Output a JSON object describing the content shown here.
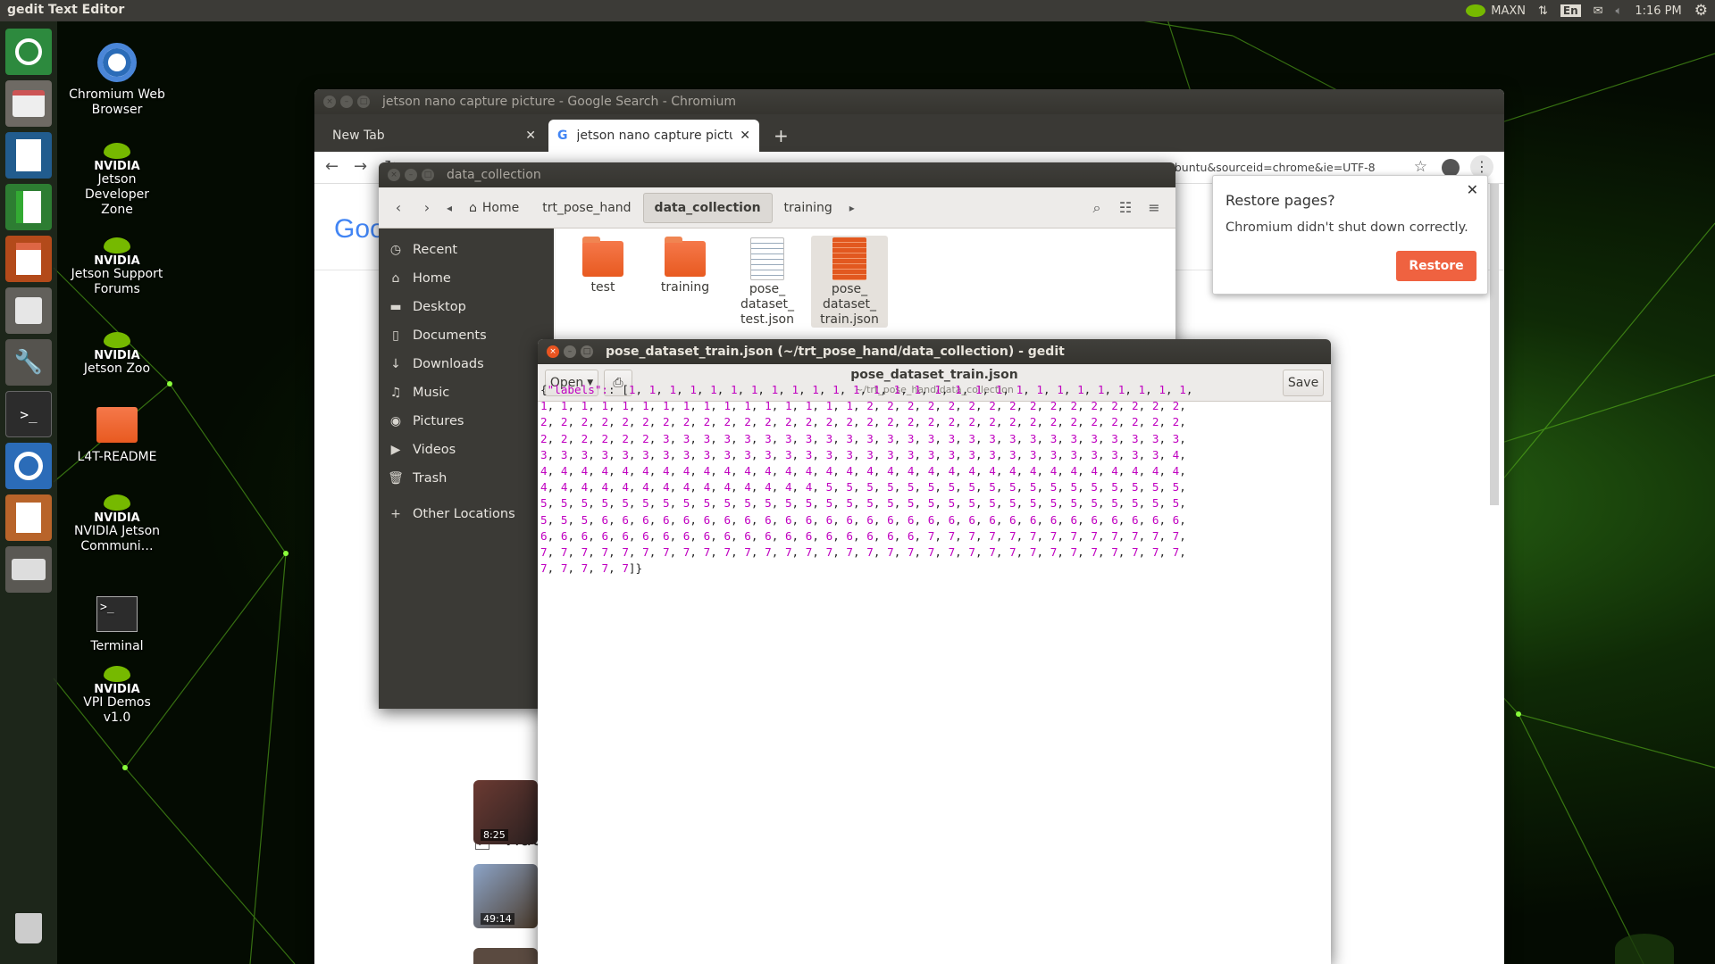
{
  "top_panel": {
    "app_title": "gedit Text Editor",
    "power_mode": "MAXN",
    "keyboard_layout": "En",
    "clock": "1:16 PM"
  },
  "launcher": {
    "items": [
      "ubuntu-dash-icon",
      "files-icon",
      "writer-icon",
      "calc-icon",
      "impress-icon",
      "software-icon",
      "settings-icon",
      "terminal-icon",
      "chromium-icon",
      "gedit-icon",
      "drive-icon",
      "trash-icon"
    ]
  },
  "desktop_icons": [
    {
      "label": "Chromium Web Browser",
      "icon": "chromium-icon"
    },
    {
      "label": "Jetson Developer Zone",
      "icon": "nvidia-icon"
    },
    {
      "label": "Jetson Support Forums",
      "icon": "nvidia-icon"
    },
    {
      "label": "Jetson Zoo",
      "icon": "nvidia-icon"
    },
    {
      "label": "L4T-README",
      "icon": "folder-icon"
    },
    {
      "label": "NVIDIA Jetson Communi…",
      "icon": "nvidia-icon"
    },
    {
      "label": "Terminal",
      "icon": "terminal-icon"
    },
    {
      "label": "VPI Demos v1.0",
      "icon": "nvidia-icon"
    }
  ],
  "nvidia_word": "NVIDIA",
  "chromium": {
    "window_title": "jetson nano capture picture - Google Search - Chromium",
    "tabs": [
      {
        "label": "New Tab"
      },
      {
        "label": "jetson nano capture pictu"
      }
    ],
    "new_tab": "+",
    "url": "google.com/search?q=jetson+nano+capture+picture&oq=jetson+nano+capture+picture&aqs=chrome..69i57.7408j0j7&client=ubuntu&sourceid=chrome&ie=UTF-8",
    "logo_fragment": "Goo",
    "section_heading": "Vide",
    "video_durations": [
      "8:25",
      "49:14"
    ],
    "restore_popup": {
      "title": "Restore pages?",
      "message": "Chromium didn't shut down correctly.",
      "button": "Restore"
    }
  },
  "files": {
    "window_title": "data_collection",
    "breadcrumbs": [
      "Home",
      "trt_pose_hand",
      "data_collection",
      "training"
    ],
    "sidebar": [
      {
        "label": "Recent",
        "icon": "clock-icon"
      },
      {
        "label": "Home",
        "icon": "home-icon"
      },
      {
        "label": "Desktop",
        "icon": "desktop-icon"
      },
      {
        "label": "Documents",
        "icon": "document-icon"
      },
      {
        "label": "Downloads",
        "icon": "download-icon"
      },
      {
        "label": "Music",
        "icon": "music-icon"
      },
      {
        "label": "Pictures",
        "icon": "camera-icon"
      },
      {
        "label": "Videos",
        "icon": "video-icon"
      },
      {
        "label": "Trash",
        "icon": "trash-icon"
      },
      {
        "label": "Other Locations",
        "icon": "plus-icon"
      }
    ],
    "items": [
      {
        "name": "test",
        "type": "folder"
      },
      {
        "name": "training",
        "type": "folder"
      },
      {
        "name": "pose_ dataset_ test.json",
        "type": "text"
      },
      {
        "name": "pose_ dataset_ train.json",
        "type": "json-selected"
      }
    ]
  },
  "gedit": {
    "window_title": "pose_dataset_train.json (~/trt_pose_hand/data_collection) - gedit",
    "open_button": "Open",
    "save_button": "Save",
    "doc_title": "pose_dataset_train.json",
    "doc_path": "~/trt_pose_hand/data_collection",
    "json_prefix": "{\"labels\": [",
    "json_suffix": "]}",
    "label_runs": [
      {
        "value": 1,
        "count": 44
      },
      {
        "value": 2,
        "count": 54
      },
      {
        "value": 3,
        "count": 57
      },
      {
        "value": 4,
        "count": 47
      },
      {
        "value": 5,
        "count": 53
      },
      {
        "value": 6,
        "count": 48
      },
      {
        "value": 7,
        "count": 50
      }
    ],
    "line_wrap": 32
  }
}
